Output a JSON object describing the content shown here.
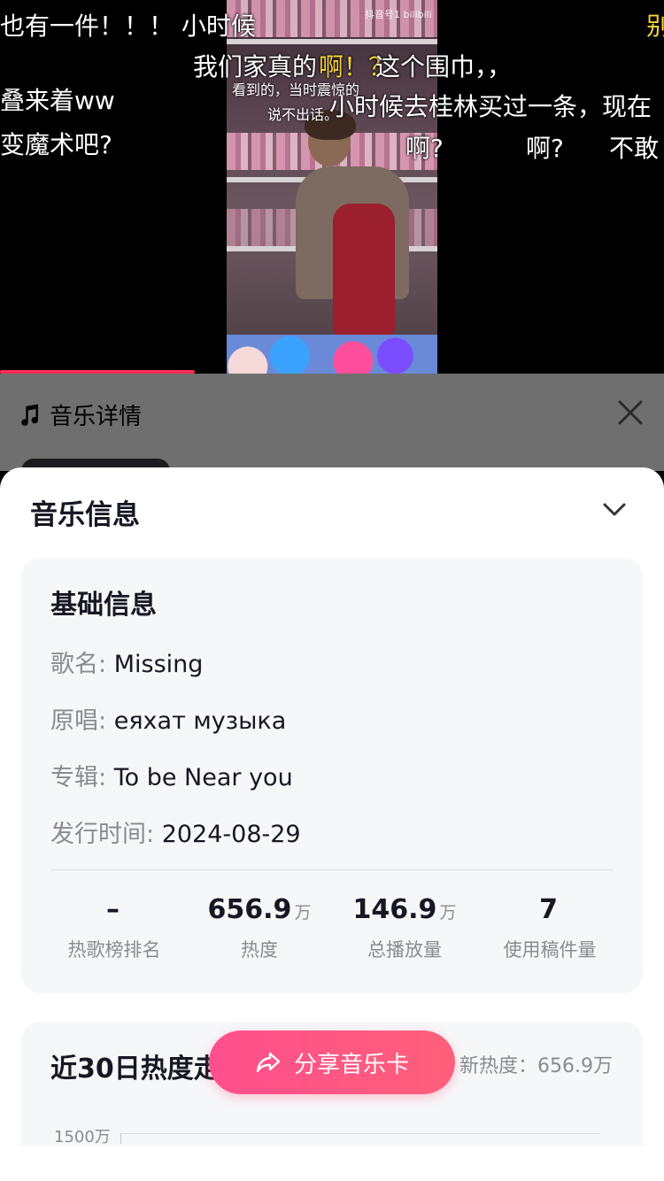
{
  "video": {
    "watermark": "抖音号1  bilibili",
    "danmaku": [
      "也有一件！！！ 小时候",
      "我们家真的",
      "这个围巾，，",
      "叠来着ww",
      "小时候去桂林买过一条，现在",
      "变魔术吧?",
      "啊?",
      "啊?",
      "不敢",
      "别",
      "啊！？"
    ],
    "subtitle_line1": "看到的，当时震惊的",
    "subtitle_line2": "说不出话。"
  },
  "header": {
    "title": "音乐详情"
  },
  "sheet": {
    "title": "音乐信息",
    "basic": {
      "title": "基础信息",
      "song_label": "歌名:",
      "song_value": "Missing",
      "artist_label": "原唱:",
      "artist_value": "еяхат музыка",
      "album_label": "专辑:",
      "album_value": "To be Near you",
      "release_label": "发行时间:",
      "release_value": "2024-08-29"
    },
    "stats": [
      {
        "value": "–",
        "unit": "",
        "label": "热歌榜排名"
      },
      {
        "value": "656.9",
        "unit": "万",
        "label": "热度"
      },
      {
        "value": "146.9",
        "unit": "万",
        "label": "总播放量"
      },
      {
        "value": "7",
        "unit": "",
        "label": "使用稿件量"
      }
    ],
    "trend": {
      "title": "近30日热度走",
      "latest": "新热度：656.9万",
      "ytick_top": "1500万"
    }
  },
  "share_button": {
    "label": "分享音乐卡"
  },
  "colors": {
    "accent": "#fe2c55",
    "share_gradient_start": "#ff4f8e",
    "share_gradient_end": "#ff5f7a"
  }
}
